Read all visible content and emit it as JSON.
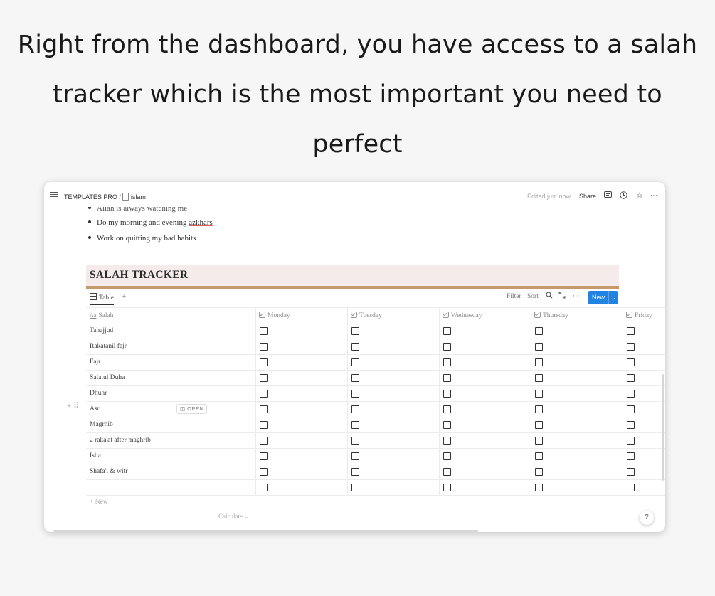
{
  "headline": {
    "line1": "Right from the dashboard, you have access to a salah",
    "line2": "tracker which is the most important you need to",
    "line3": "perfect"
  },
  "topbar": {
    "workspace": "TEMPLATES PRO",
    "separator": "/",
    "page": "islam",
    "edited": "Edited just now",
    "share": "Share",
    "icons": [
      "menu-icon",
      "comment-icon",
      "clock-icon",
      "star-icon",
      "more-icon"
    ]
  },
  "bullets": [
    "Allah is always watching me",
    "Do my morning and evening azkhars",
    "Work on quitting my bad habits"
  ],
  "tracker": {
    "title": "SALAH TRACKER"
  },
  "db": {
    "view_label": "Table",
    "add": "+",
    "filter": "Filter",
    "sort": "Sort",
    "more": "···",
    "new_label": "New",
    "new_chevron": "⌄"
  },
  "table": {
    "columns": [
      "Salah",
      "Monday",
      "Tuesday",
      "Wednesday",
      "Thursday",
      "Friday"
    ],
    "title_prefix": "Aa",
    "rows": [
      "Tahajjud",
      "Rakatanil fajr",
      "Fajr",
      "Salatul Duha",
      "Dhuhr",
      "Asr",
      "Magrhib",
      "2 raka'at after maghrib",
      "Isha",
      "Shafa'i & witr",
      ""
    ],
    "open_label": "OPEN",
    "new_row": "+ New",
    "calculate": "Calculate ⌄"
  },
  "help": "?"
}
